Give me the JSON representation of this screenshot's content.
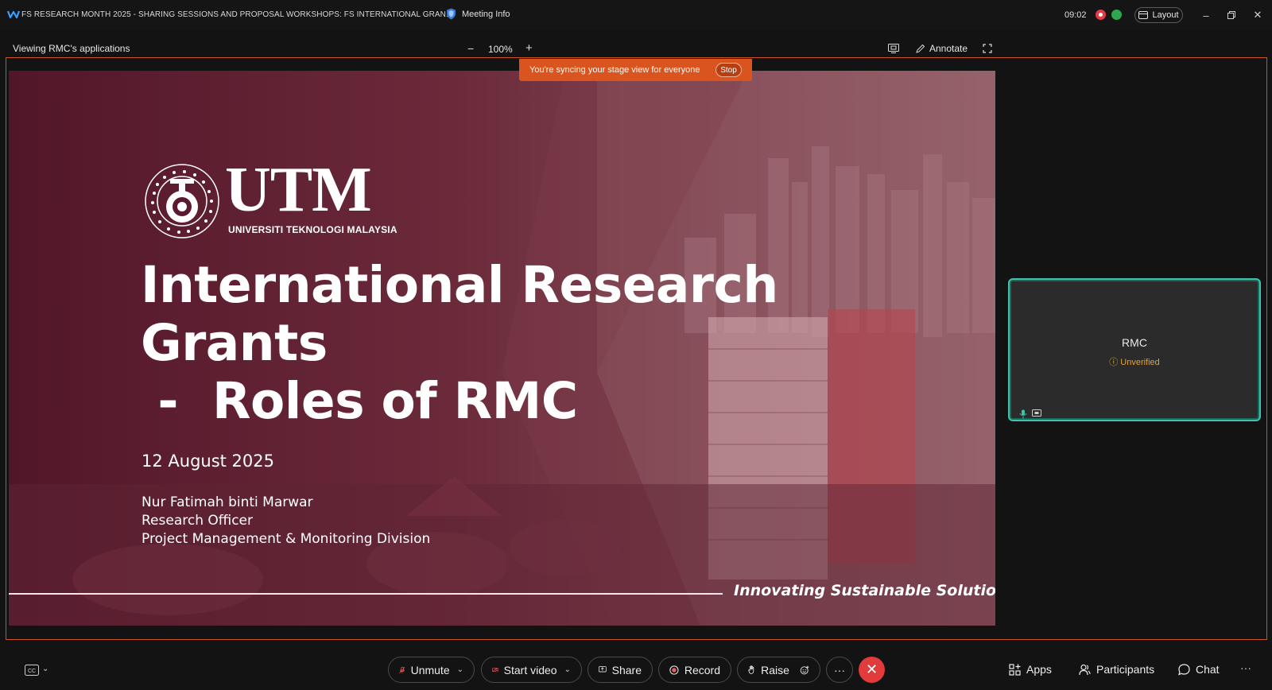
{
  "window": {
    "title": "FS RESEARCH MONTH 2025 - SHARING SESSIONS AND PROPOSAL WORKSHOPS: FS INTERNATIONAL GRAN...",
    "meeting_info_label": "Meeting Info",
    "clock": "09:02",
    "layout_label": "Layout"
  },
  "share_toolbar": {
    "viewing_label": "Viewing RMC's applications",
    "zoom_out": "−",
    "zoom_level": "100%",
    "zoom_in": "+",
    "annotate_label": "Annotate"
  },
  "sync_banner": {
    "message": "You're syncing your stage view for everyone",
    "stop_label": "Stop"
  },
  "slide": {
    "logo_ring_text": "KERANA TUHAN UNTUK MANUSIA · UNIVERSITI TEKNOLOGI MALAYSIA",
    "logo_wordmark": "UTM",
    "logo_subtitle": "UNIVERSITI TEKNOLOGI MALAYSIA",
    "title_line1": "International Research",
    "title_line2": "Grants",
    "title_line3": " -  Roles of RMC",
    "date": "12 August 2025",
    "presenter_name": "Nur Fatimah binti Marwar",
    "presenter_role": "Research Officer",
    "presenter_division": "Project Management & Monitoring Division",
    "tagline": "Innovating Sustainable Solutions"
  },
  "participant": {
    "name": "RMC",
    "status": "Unverified"
  },
  "toolbar": {
    "unmute": "Unmute",
    "start_video": "Start video",
    "share": "Share",
    "record": "Record",
    "raise": "Raise",
    "more": "···",
    "apps": "Apps",
    "participants": "Participants",
    "chat": "Chat",
    "overflow": "···"
  },
  "colors": {
    "accent_orange": "#d9541f",
    "tile_border": "#43c2ab",
    "leave_red": "#e23b3b",
    "unverified": "#e0a33a"
  }
}
